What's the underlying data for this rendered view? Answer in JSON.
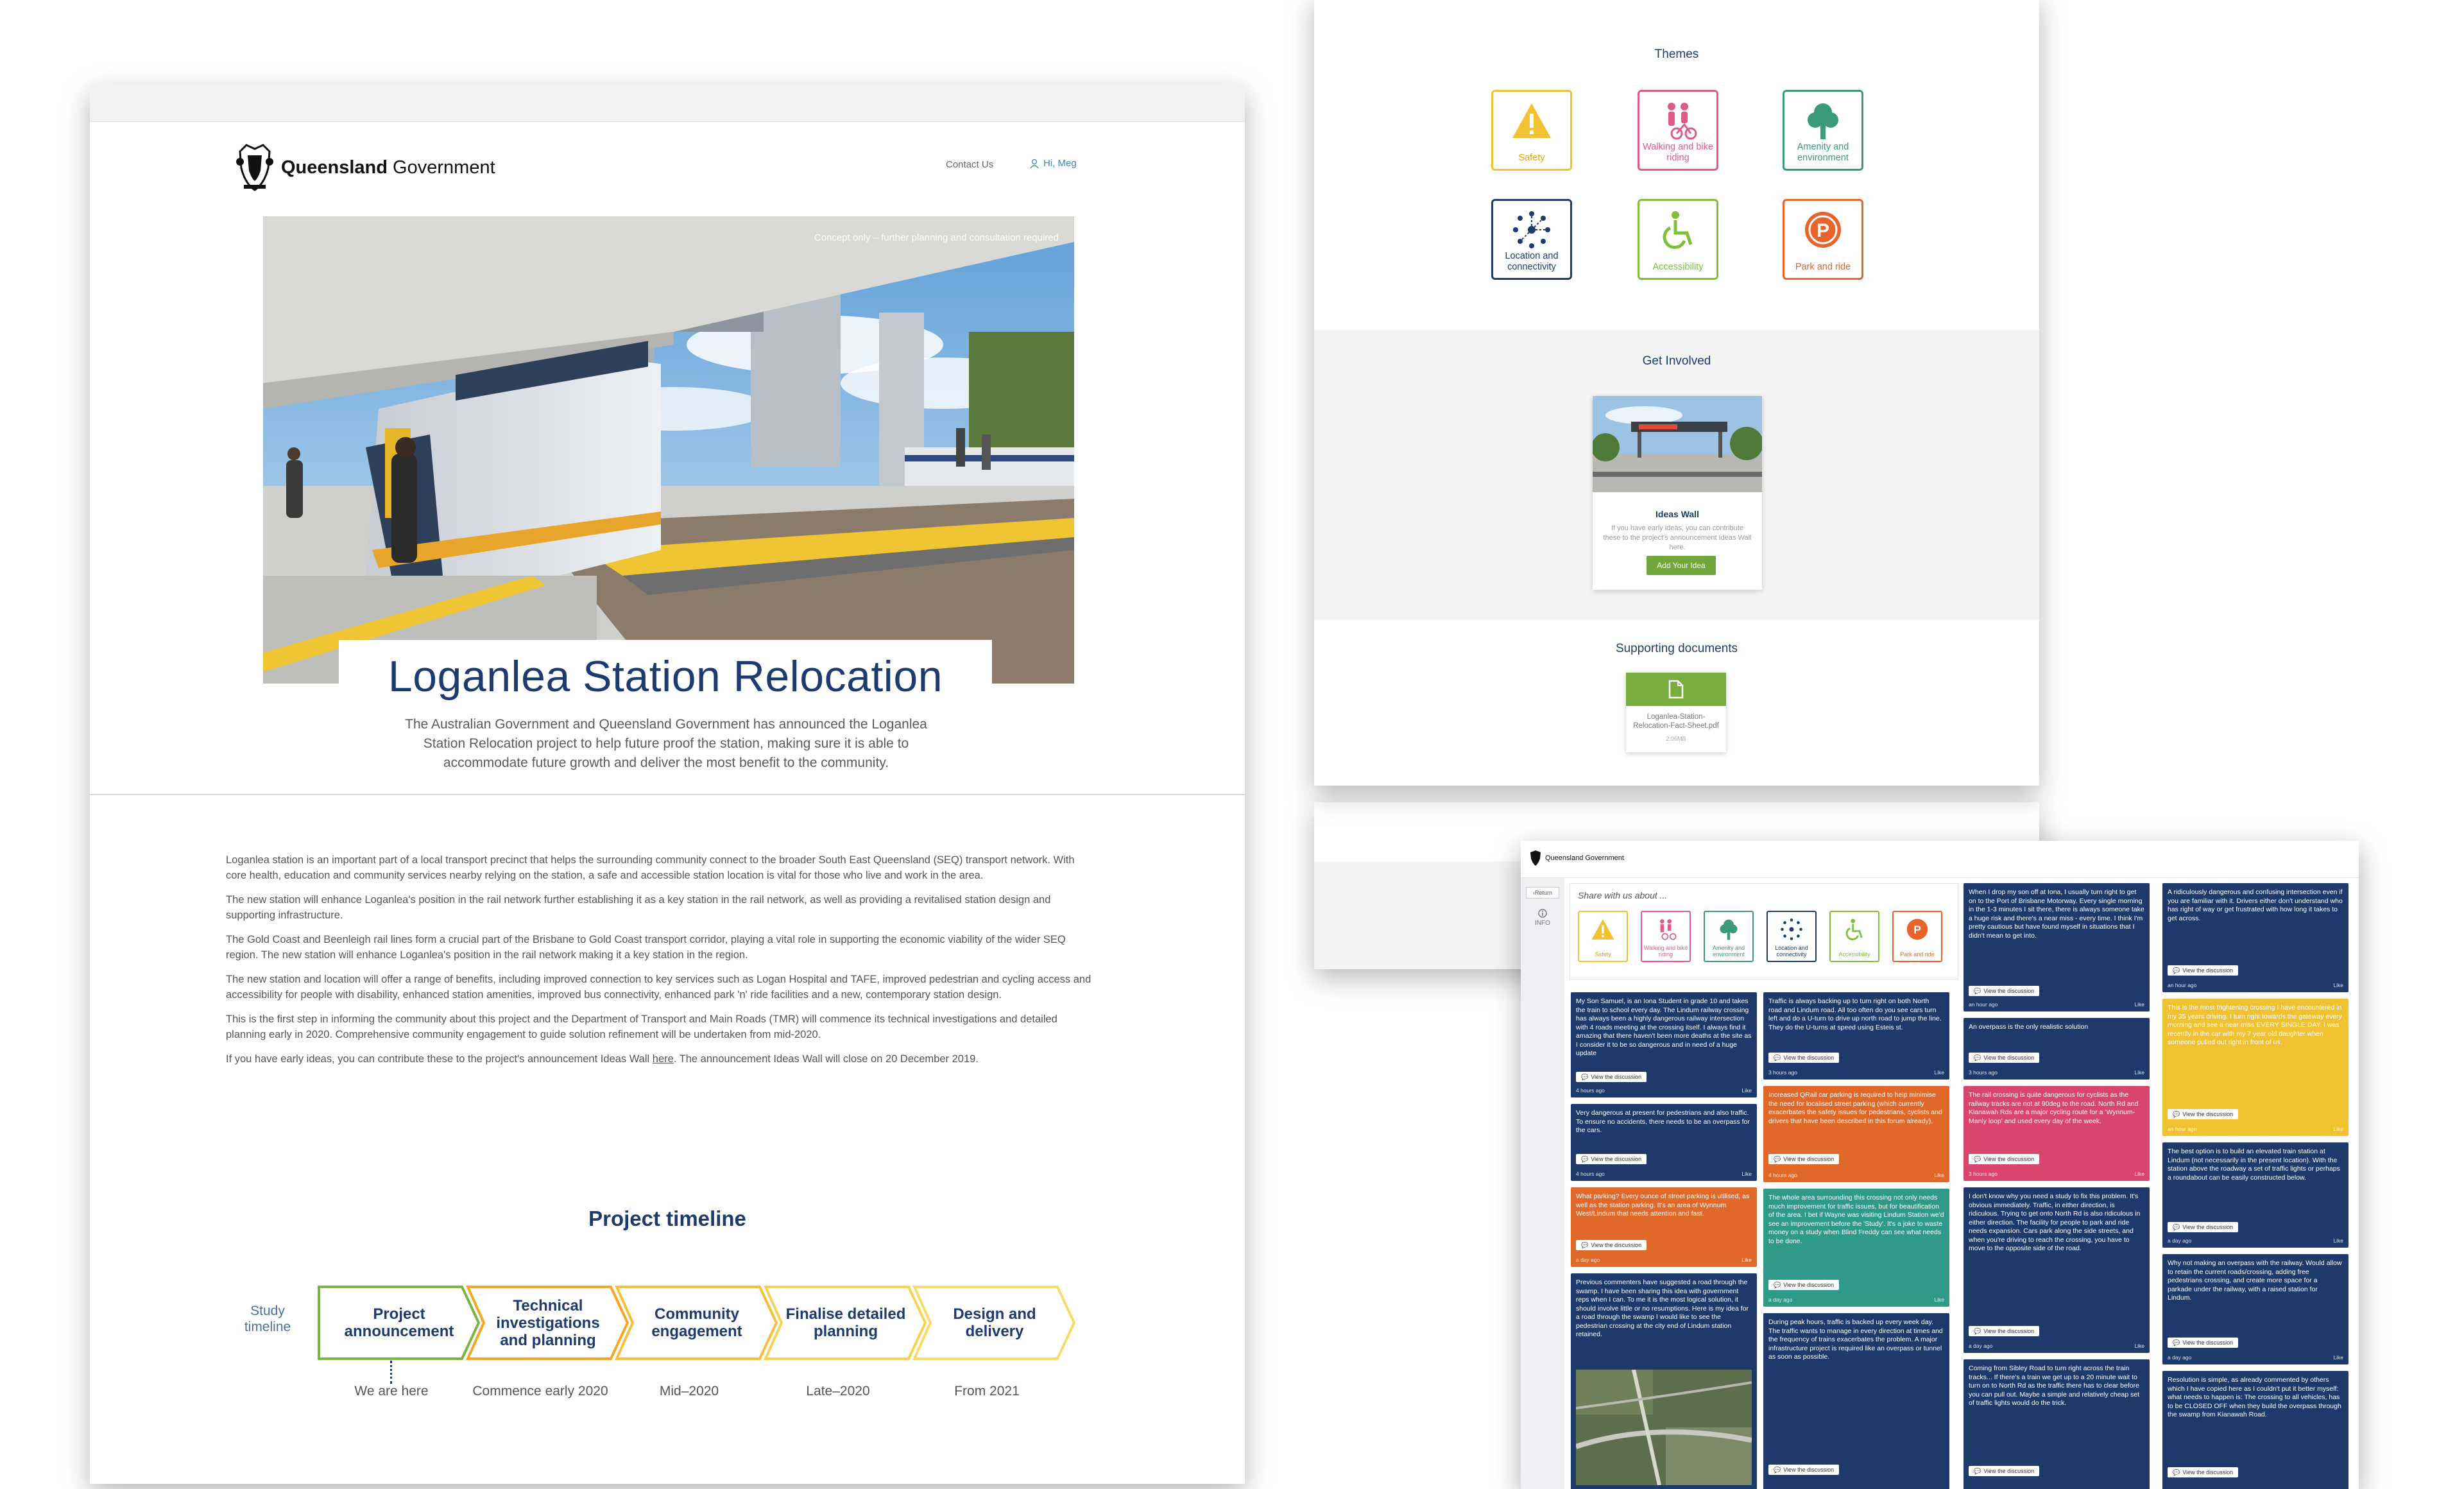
{
  "colors": {
    "navy": "#1d3b6e",
    "accent_blue": "#3a87c9",
    "green": "#6fa73a",
    "safety_yellow": "#f2c230",
    "walking_pink": "#e05a86",
    "amenity_teal": "#3c9a7c",
    "accessibility_green": "#7fbf3d",
    "park_orange": "#e8642a",
    "card_navy": "#1e3a6a",
    "card_orange": "#e0692a",
    "card_teal": "#2f9a88",
    "card_pink": "#d8466e",
    "card_yellow": "#f0c232"
  },
  "main_page": {
    "brand_bold": "Queensland",
    "brand_rest": " Government",
    "nav_contact": "Contact Us",
    "nav_user": "Hi, Meg",
    "hero_caption": "Concept only – further planning and consultation required",
    "title": "Loganlea Station Relocation",
    "intro": "The Australian Government and Queensland Government has announced the Loganlea Station Relocation project to help future proof the station, making sure it is able to accommodate future growth and deliver the most benefit to the community.",
    "paragraphs": [
      "Loganlea station is an important part of a local transport precinct that helps the surrounding community connect to the broader South East Queensland (SEQ) transport network. With core health, education and community services nearby relying on the station, a safe and accessible station location is vital for those who live and work in the area.",
      "The new station will enhance Loganlea's position in the rail network further establishing it as a key station in the rail network, as well as providing a revitalised station design and supporting infrastructure.",
      "The Gold Coast and Beenleigh rail lines form a crucial part of the Brisbane to Gold Coast transport corridor, playing a vital role in supporting the economic viability of the wider SEQ region. The new station will enhance Loganlea's position in the rail network making it a key station in the region.",
      "The new station and location will offer a range of benefits, including improved connection to key services such as Logan Hospital and TAFE, improved pedestrian and cycling access and accessibility for people with disability, enhanced station amenities, improved bus connectivity, enhanced park 'n' ride facilities and a new, contemporary station design.",
      "This is the first step in informing the community about this project and the Department of Transport and Main Roads (TMR) will commence its technical investigations and detailed planning early in 2020. Comprehensive community engagement to guide solution refinement will be undertaken from mid-2020."
    ],
    "last_para_before": "If you have early ideas, you can contribute these to the project's announcement Ideas Wall ",
    "last_para_link": "here",
    "last_para_after": ". The announcement Ideas Wall will close on 20 December 2019.",
    "timeline_heading": "Project timeline",
    "timeline_side": "Study timeline",
    "timeline": [
      {
        "label": "Project announcement",
        "date": "We are here"
      },
      {
        "label": "Technical investigations and planning",
        "date": "Commence early 2020"
      },
      {
        "label": "Community engagement",
        "date": "Mid–2020"
      },
      {
        "label": "Finalise detailed planning",
        "date": "Late–2020"
      },
      {
        "label": "Design and delivery",
        "date": "From 2021"
      }
    ]
  },
  "themes_page": {
    "themes_heading": "Themes",
    "themes": [
      {
        "label": "Safety",
        "icon": "warning-icon"
      },
      {
        "label": "Walking and bike riding",
        "icon": "pedestrian-cyclist-icon"
      },
      {
        "label": "Amenity and environment",
        "icon": "tree-icon"
      },
      {
        "label": "Location and connectivity",
        "icon": "network-icon"
      },
      {
        "label": "Accessibility",
        "icon": "wheelchair-icon"
      },
      {
        "label": "Park and ride",
        "icon": "parking-icon"
      }
    ],
    "involved_heading": "Get Involved",
    "ideas_wall_title": "Ideas Wall",
    "ideas_wall_desc": "If you have early ideas, you can contribute these to the project's announcement Ideas Wall here.",
    "ideas_wall_button": "Add Your Idea",
    "docs_heading": "Supporting documents",
    "doc_name": "Loganlea-Station-Relocation-Fact-Sheet.pdf",
    "doc_size": "2.06MB"
  },
  "ideas_wall": {
    "brand": "Queensland Government",
    "return_label": "Return",
    "info_label": "INFO",
    "share_title": "Share with us about ...",
    "mini_themes": [
      "Safety",
      "Walking and bike riding",
      "Amenity and environment",
      "Location and connectivity",
      "Accessibility",
      "Park and ride"
    ],
    "view_label": "View the discussion",
    "like_label": "Like",
    "cards": [
      {
        "text": "My Son Samuel, is an Iona Student in grade 10 and takes the train to school every day. The Lindum railway crossing has always been a highly dangerous railway intersection with 4 roads meeting at the crossing itself. I always find it amazing that there haven't been more deaths at the site as I consider it to be so dangerous and in need of a huge update",
        "meta": "4 hours ago"
      },
      {
        "text": "Very dangerous at present for pedestrians and also traffic. To ensure no accidents, there needs to be an overpass for the cars.",
        "meta": "4 hours ago"
      },
      {
        "text": "What parking? Every ounce of street parking is utilised, as well as the station parking. It's an area of Wynnum West/Lindum that needs attention and fast.",
        "meta": "a day ago"
      },
      {
        "text": "Previous commenters have suggested a road through the swamp. I have been sharing this idea with government reps when I can. To me it is the most logical solution, it should involve little or no resumptions. Here is my idea for a road through the swamp I would like to see the pedestrian crossing at the city end of Lindum station retained.",
        "meta": "a day ago"
      },
      {
        "text": "Traffic is always backing up to turn right on both North road and Lindum road. All too often do you see cars turn left and do a U-turn to drive up north road to jump the line. They do the U-turns at speed using Esteis st.",
        "meta": "3 hours ago"
      },
      {
        "text": "Increased QRail car parking is required to help minimise the need for localised street parking (which currently exacerbates the safety issues for pedestrians, cyclists and drivers that have been described in this forum already).",
        "meta": "4 hours ago"
      },
      {
        "text": "The whole area surrounding this crossing not only needs much improvement for traffic issues, but for beautification of the area. I bet if Wayne was visiting Lindum Station we'd see an improvement before the 'Study'. It's a joke to waste money on a study when Blind Freddy can see what needs to be done.",
        "meta": "a day ago"
      },
      {
        "text": "During peak hours, traffic is backed up every week day. The traffic wants to manage in every direction at times and the frequency of trains exacerbates the problem. A major infrastructure project is required like an overpass or tunnel as soon as possible.",
        "meta": "a day ago"
      },
      {
        "text": "When I drop my son off at Iona, I usually turn right to get on to the Port of Brisbane Motorway. Every single morning in the 1-3 minutes I sit there, there is always someone take a huge risk and there's a near miss - every time. I think I'm pretty cautious but have found myself in situations that I didn't mean to get into.",
        "meta": "an hour ago"
      },
      {
        "text": "An overpass is the only realistic solution",
        "meta": "3 hours ago"
      },
      {
        "text": "The rail crossing is quite dangerous for cyclists as the railway tracks are not at 90deg to the road. North Rd and Kianawah Rds are a major cycling route for a 'Wynnum-Manly loop' and used every day of the week.",
        "meta": "3 hours ago"
      },
      {
        "text": "I don't know why you need a study to fix this problem. It's obvious immediately. Traffic, in either direction, is ridiculous. Trying to get onto North Rd is also ridiculous in either direction. The facility for people to park and ride needs expansion. Cars park along the side streets, and when you're driving to reach the crossing, you have to move to the opposite side of the road.",
        "meta": "a day ago"
      },
      {
        "text": "Coming from Sibley Road to turn right across the train tracks... If there's a train we get up to a 20 minute wait to turn on to North Rd as the traffic there has to clear before you can pull out. Maybe a simple and relatively cheap set of traffic lights would do the trick.",
        "meta": "a day ago"
      },
      {
        "text": "A ridiculously dangerous and confusing intersection even if you are familiar with it. Drivers either don't understand who has right of way or get frustrated with how long it takes to get across.",
        "meta": "an hour ago"
      },
      {
        "text": "This is the most frightening crossing I have encountered in my 35 years driving. I turn right towards the gateway every morning and see a near miss EVERY SINGLE DAY. I was recently in the car with my 7 year old daughter when someone pulled out right in front of us.",
        "meta": "an hour ago"
      },
      {
        "text": "The best option is to build an elevated train station at Lindum (not necessarily in the present location). With the station above the roadway a set of traffic lights or perhaps a roundabout can be easily constructed below.",
        "meta": "a day ago"
      },
      {
        "text": "Why not making an overpass with the railway. Would allow to retain the current roads/crossing, adding free pedestrians crossing, and create more space for a parkade under the railway, with a raised station for Lindum.",
        "meta": "a day ago"
      },
      {
        "text": "Resolution is simple, as already commented by others which I have copied here as I couldn't put it better myself: what needs to happen is: The crossing to all vehicles, has to be CLOSED OFF when they build the overpass through the swamp from Kianawah Road.",
        "meta": "a day ago"
      }
    ]
  }
}
